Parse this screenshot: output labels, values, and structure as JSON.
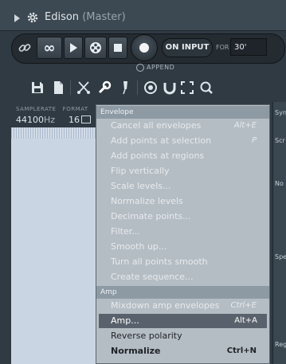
{
  "window": {
    "title": "Edison",
    "subtitle": "(Master)"
  },
  "transport": {
    "loop_label": "∞",
    "record_mode": "ON INPUT",
    "for_label": "FOR",
    "for_value": "30'",
    "append_label": "APPEND"
  },
  "readout": {
    "samplerate_label": "SAMPLERATE",
    "samplerate_value": "44100",
    "samplerate_unit": "Hz",
    "format_label": "FORMAT",
    "format_value": "16"
  },
  "right_panel": {
    "labels": [
      "Syn",
      "Scr",
      "No",
      "Spe",
      "Reg"
    ]
  },
  "menu": {
    "envelope_header": "Envelope",
    "envelope_items": [
      {
        "label": "Cancel all envelopes",
        "shortcut": "Alt+E"
      },
      {
        "label": "Add points at selection",
        "shortcut": "P"
      },
      {
        "label": "Add points at regions",
        "shortcut": ""
      },
      {
        "label": "Flip vertically",
        "shortcut": ""
      },
      {
        "label": "Scale levels...",
        "shortcut": ""
      },
      {
        "label": "Normalize levels",
        "shortcut": ""
      },
      {
        "label": "Decimate points...",
        "shortcut": ""
      },
      {
        "label": "Filter...",
        "shortcut": ""
      },
      {
        "label": "Smooth up...",
        "shortcut": ""
      },
      {
        "label": "Turn all points smooth",
        "shortcut": ""
      },
      {
        "label": "Create sequence...",
        "shortcut": ""
      }
    ],
    "amp_header": "Amp",
    "amp_items": [
      {
        "label": "Mixdown amp envelopes",
        "shortcut": "Ctrl+E"
      },
      {
        "label": "Amp...",
        "shortcut": "Alt+A"
      },
      {
        "label": "Reverse polarity",
        "shortcut": ""
      },
      {
        "label": "Normalize",
        "shortcut": "Ctrl+N"
      }
    ]
  },
  "colors": {
    "menu_bg": "#b5bdc4",
    "menu_header": "#8e9aa3",
    "highlight": "#59626c",
    "waveform_bg": "#c9d5e3"
  }
}
